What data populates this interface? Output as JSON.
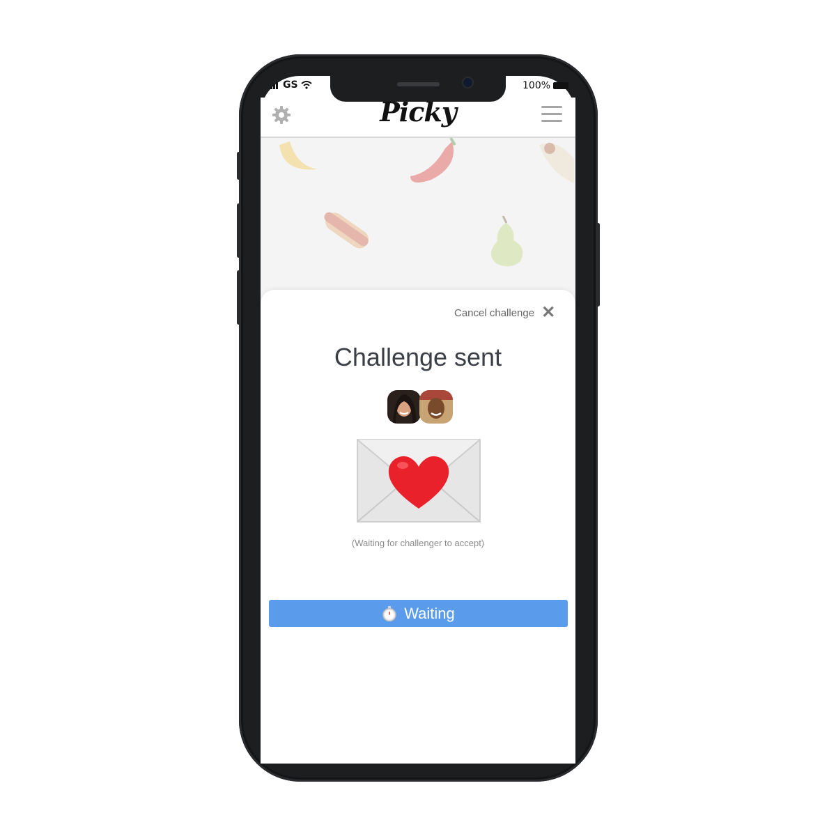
{
  "status_bar": {
    "carrier": "GS",
    "battery": "100%"
  },
  "header": {
    "logo": "Picky"
  },
  "sheet": {
    "cancel_label": "Cancel challenge",
    "title": "Challenge sent",
    "waiting_note": "(Waiting for challenger to accept)",
    "button_label": "Waiting"
  },
  "colors": {
    "accent": "#5a9ceb",
    "heart": "#e8212b",
    "frame": "#1d1e20"
  },
  "icons": [
    "signal-icon",
    "wifi-icon",
    "battery-icon",
    "gear-icon",
    "menu-icon",
    "close-icon",
    "envelope-heart-icon",
    "stopwatch-icon"
  ]
}
